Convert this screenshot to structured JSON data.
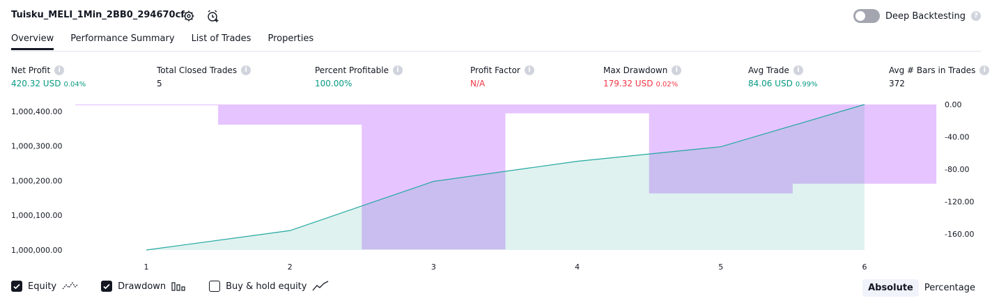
{
  "header": {
    "strategy_name": "Tuisku_MELI_1Min_2BB0_294670cf",
    "settings_icon": "gear-icon",
    "alert_icon": "alarm-clock-plus-icon",
    "deep_backtesting_label": "Deep Backtesting",
    "deep_backtesting_enabled": false
  },
  "tabs": [
    {
      "label": "Overview",
      "active": true
    },
    {
      "label": "Performance Summary",
      "active": false
    },
    {
      "label": "List of Trades",
      "active": false
    },
    {
      "label": "Properties",
      "active": false
    }
  ],
  "metrics": {
    "net_profit": {
      "label": "Net Profit",
      "value": "420.32 USD",
      "pct": "0.04%"
    },
    "total_closed_trades": {
      "label": "Total Closed Trades",
      "value": "5"
    },
    "percent_profitable": {
      "label": "Percent Profitable",
      "value": "100.00%"
    },
    "profit_factor": {
      "label": "Profit Factor",
      "value": "N/A"
    },
    "max_drawdown": {
      "label": "Max Drawdown",
      "value": "179.32 USD",
      "pct": "0.02%"
    },
    "avg_trade": {
      "label": "Avg Trade",
      "value": "84.06 USD",
      "pct": "0.99%"
    },
    "avg_bars": {
      "label": "Avg # Bars in Trades",
      "value": "372"
    }
  },
  "chart_data": {
    "type": "line",
    "x": [
      1,
      2,
      3,
      4,
      5,
      6
    ],
    "series": [
      {
        "name": "Equity",
        "type": "area",
        "values": [
          1000000,
          1000056,
          1000198,
          1000256,
          1000298,
          1000420
        ],
        "color": "#089981"
      },
      {
        "name": "Drawdown",
        "type": "bar",
        "axis": "right",
        "bars": [
          {
            "from": 0.5,
            "to": 1.5,
            "value": -1
          },
          {
            "from": 1.5,
            "to": 2.5,
            "value": -25
          },
          {
            "from": 2.5,
            "to": 3.5,
            "value": -179.32
          },
          {
            "from": 3.5,
            "to": 4.5,
            "value": -11
          },
          {
            "from": 4.5,
            "to": 5.5,
            "value": -110
          },
          {
            "from": 5.5,
            "to": 6.5,
            "value": -98
          }
        ],
        "color": "#c77dff"
      }
    ],
    "y_left": {
      "ticks": [
        "1,000,400.00",
        "1,000,300.00",
        "1,000,200.00",
        "1,000,100.00",
        "1,000,000.00"
      ],
      "range": [
        1000000,
        1000420
      ]
    },
    "y_right": {
      "ticks": [
        "0.00",
        "-40.00",
        "-80.00",
        "-120.00",
        "-160.00"
      ],
      "range": [
        -180,
        0
      ]
    },
    "x_ticks": [
      "1",
      "2",
      "3",
      "4",
      "5",
      "6"
    ]
  },
  "legend": [
    {
      "label": "Equity",
      "checked": true,
      "icon": "equity-line-icon"
    },
    {
      "label": "Drawdown",
      "checked": true,
      "icon": "drawdown-bars-icon"
    },
    {
      "label": "Buy & hold equity",
      "checked": false,
      "icon": "buy-hold-line-icon"
    }
  ],
  "view_toggle": {
    "absolute": "Absolute",
    "percentage": "Percentage",
    "selected": "Absolute"
  }
}
